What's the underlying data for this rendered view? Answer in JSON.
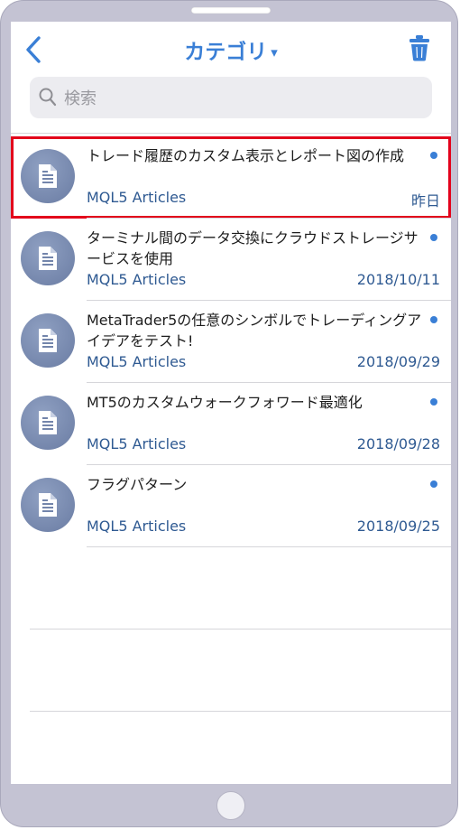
{
  "nav": {
    "title": "カテゴリ",
    "caret": "▾"
  },
  "search": {
    "placeholder": "検索"
  },
  "articles": [
    {
      "title": "トレード履歴のカスタム表示とレポート図の作成",
      "source": "MQL5 Articles",
      "date": "昨日",
      "selected": true
    },
    {
      "title": "ターミナル間のデータ交換にクラウドストレージサービスを使用",
      "source": "MQL5 Articles",
      "date": "2018/10/11",
      "selected": false
    },
    {
      "title": "MetaTrader5の任意のシンボルでトレーディングアイデアをテスト!",
      "source": "MQL5 Articles",
      "date": "2018/09/29",
      "selected": false
    },
    {
      "title": "MT5のカスタムウォークフォワード最適化",
      "source": "MQL5 Articles",
      "date": "2018/09/28",
      "selected": false
    },
    {
      "title": "フラグパターン",
      "source": "MQL5 Articles",
      "date": "2018/09/25",
      "selected": false
    }
  ],
  "colors": {
    "accent": "#3a7fd6",
    "selection_outline": "#e3001b",
    "frame": "#c4c3d3",
    "source_text": "#2f5a92"
  }
}
